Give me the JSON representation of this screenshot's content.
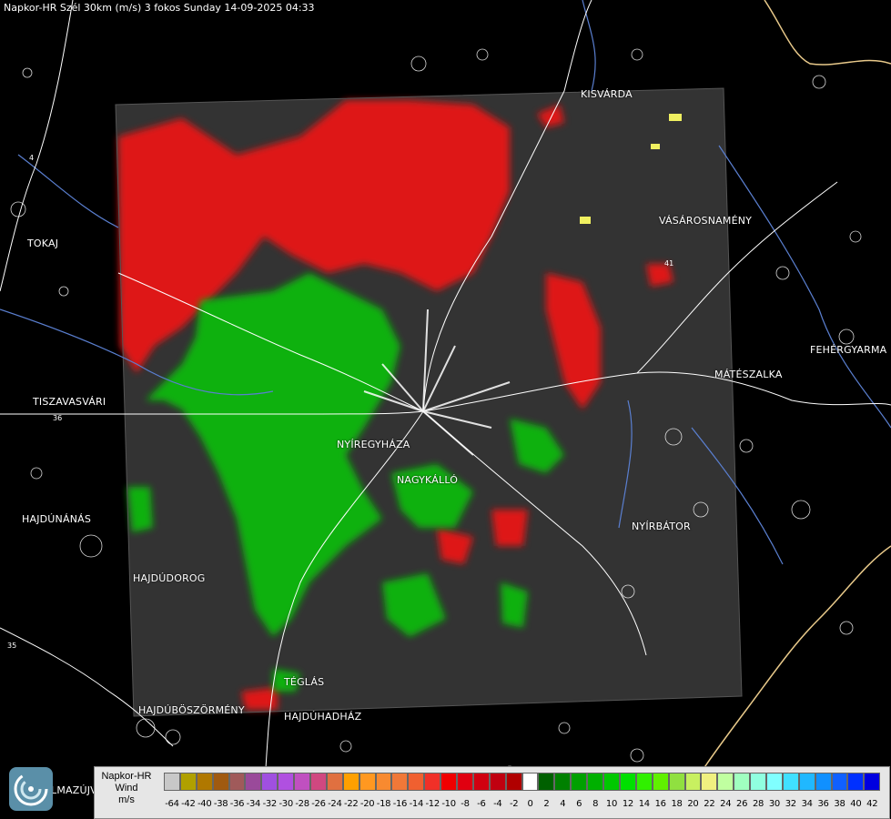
{
  "header": {
    "title": "Napkor-HR Szél 30km (m/s) 3 fokos Sunday 14-09-2025 04:33"
  },
  "map": {
    "cities": [
      {
        "id": "kisvarda",
        "name": "KISVÁRDA"
      },
      {
        "id": "tokaj",
        "name": "TOKAJ"
      },
      {
        "id": "vasarosnameny",
        "name": "VÁSÁROSNAMÉNY"
      },
      {
        "id": "fehergyarmat",
        "name": "FEHÉRGYARMA"
      },
      {
        "id": "mateszalka",
        "name": "MÁTÉSZALKA"
      },
      {
        "id": "tiszavasvari",
        "name": "TISZAVASVÁRI"
      },
      {
        "id": "nyiregyhaza",
        "name": "NYÍREGYHÁZA"
      },
      {
        "id": "nagykallo",
        "name": "NAGYKÁLLÓ"
      },
      {
        "id": "hajdunanas",
        "name": "HAJDÚNÁNÁS"
      },
      {
        "id": "nyirbator",
        "name": "NYÍRBÁTOR"
      },
      {
        "id": "hajdudorog",
        "name": "HAJDÚDOROG"
      },
      {
        "id": "teglas",
        "name": "TÉGLÁS"
      },
      {
        "id": "hajduboszormeny",
        "name": "HAJDÚBÖSZÖRMÉNY"
      },
      {
        "id": "hajduhadhaz",
        "name": "HAJDÚHADHÁZ"
      },
      {
        "id": "almazujvaros",
        "name": "LMAZÚJVÁR"
      }
    ],
    "road_numbers": [
      "4",
      "41",
      "36",
      "35"
    ],
    "colors": {
      "background": "#000000",
      "radar_bg": "#333333",
      "border": "#ffffff",
      "river": "#5a7fd0",
      "country_border": "#e8c98a"
    }
  },
  "legend": {
    "label_lines": [
      "Napkor-HR",
      "Wind",
      "m/s"
    ],
    "ticks": [
      "-64",
      "-42",
      "-40",
      "-38",
      "-36",
      "-34",
      "-32",
      "-30",
      "-28",
      "-26",
      "-24",
      "-22",
      "-20",
      "-18",
      "-16",
      "-14",
      "-12",
      "-10",
      "-8",
      "-6",
      "-4",
      "-2",
      "0",
      "2",
      "4",
      "6",
      "8",
      "10",
      "12",
      "14",
      "16",
      "18",
      "20",
      "22",
      "24",
      "26",
      "28",
      "30",
      "32",
      "34",
      "36",
      "38",
      "40",
      "42"
    ],
    "colors": [
      "#c8c8c8",
      "#b0a000",
      "#b07800",
      "#a05a10",
      "#a05a5a",
      "#9a4a9a",
      "#a050e0",
      "#b050e0",
      "#c050c0",
      "#d04880",
      "#e07040",
      "#ffa000",
      "#ff9820",
      "#f88a30",
      "#f07838",
      "#f06030",
      "#f03028",
      "#f00000",
      "#e00010",
      "#d00010",
      "#c00010",
      "#b00000",
      "#ffffff",
      "#006000",
      "#008000",
      "#00a000",
      "#00b000",
      "#00c800",
      "#00e000",
      "#30f000",
      "#60f000",
      "#90e040",
      "#c8f060",
      "#f0f080",
      "#c0ffa0",
      "#a0ffc0",
      "#90ffe0",
      "#80ffff",
      "#40e0ff",
      "#20b8ff",
      "#1090ff",
      "#1060ff",
      "#0030ff",
      "#0000e0"
    ]
  }
}
